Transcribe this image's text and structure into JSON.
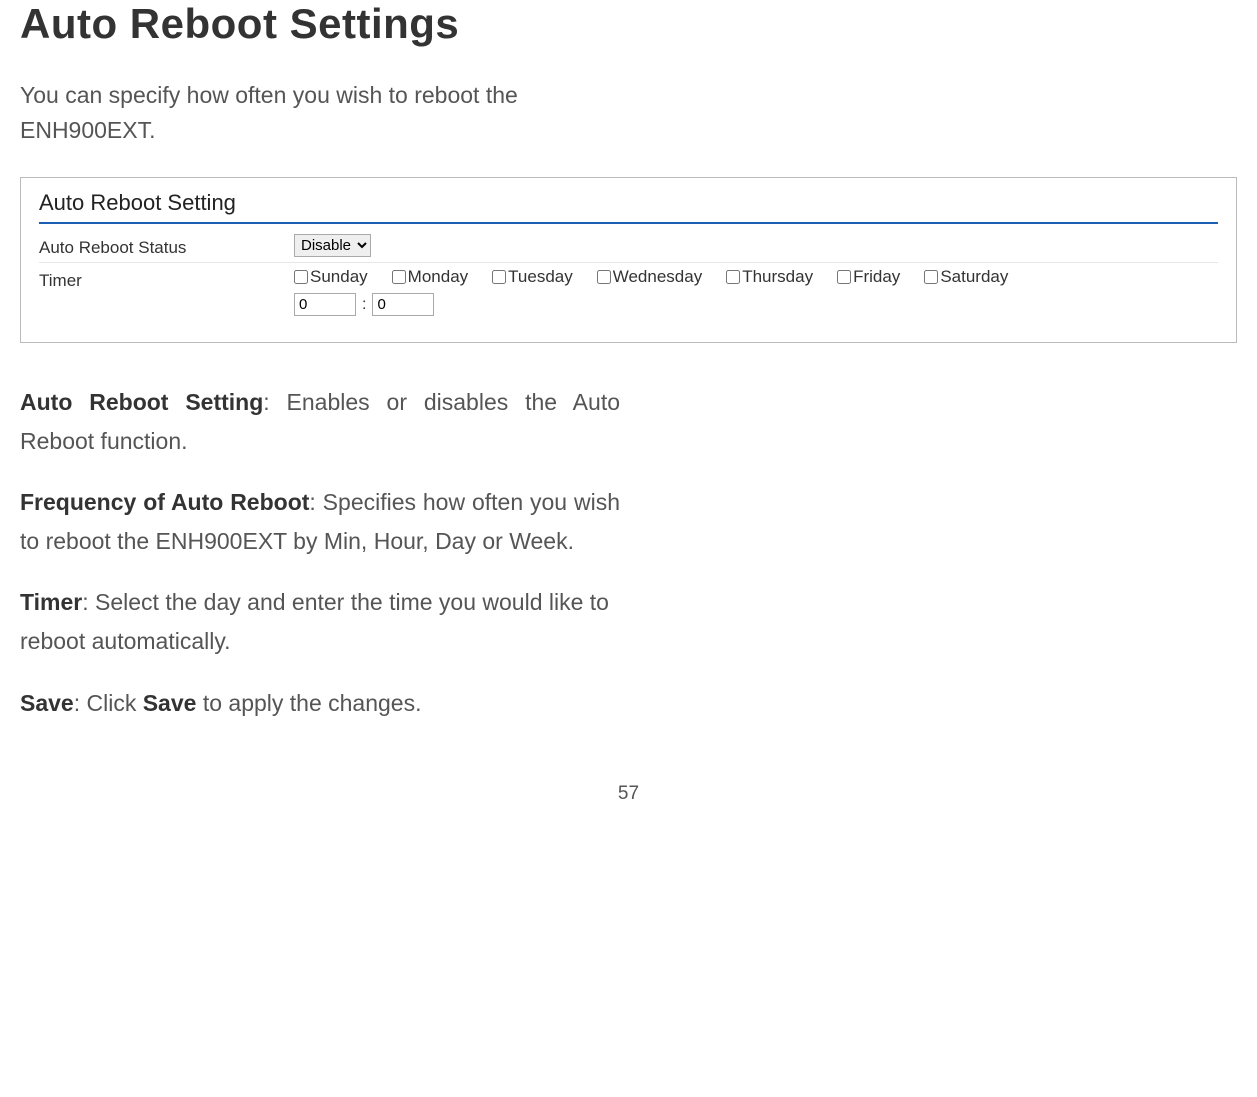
{
  "title": "Auto Reboot Settings",
  "intro": "You can specify how often you wish to reboot the ENH900EXT.",
  "panel": {
    "heading": "Auto Reboot Setting",
    "status_label": "Auto Reboot Status",
    "status_value": "Disable",
    "timer_label": "Timer",
    "days": [
      "Sunday",
      "Monday",
      "Tuesday",
      "Wednesday",
      "Thursday",
      "Friday",
      "Saturday"
    ],
    "hour_value": "0",
    "minute_value": "0",
    "time_sep": ":"
  },
  "desc": {
    "p1_bold": "Auto Reboot Setting",
    "p1_rest": ": Enables or disables the Auto Reboot function.",
    "p2_bold": "Frequency of Auto Reboot",
    "p2_rest": ": Specifies how often you wish to reboot the ENH900EXT by Min, Hour, Day or Week.",
    "p3_bold": "Timer",
    "p3_rest": ": Select the day and enter the time you would like to reboot automatically.",
    "p4_bold": "Save",
    "p4_mid": ": Click ",
    "p4_bold2": "Save",
    "p4_rest": " to apply the changes."
  },
  "page_number": "57"
}
